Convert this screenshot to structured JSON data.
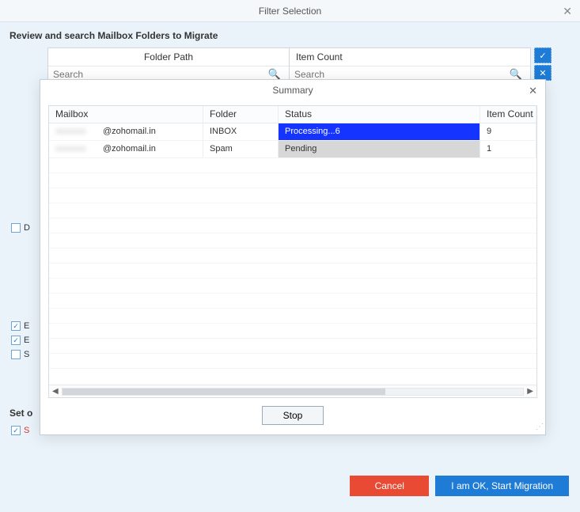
{
  "titlebar": {
    "title": "Filter Selection"
  },
  "section_label": "Review and search Mailbox Folders to Migrate",
  "filter": {
    "col1_header": "Folder Path",
    "col2_header": "Item Count",
    "search_placeholder": "Search"
  },
  "side_checks": {
    "d_label": "D",
    "e1_label": "E",
    "e2_label": "E",
    "s_label": "S",
    "set_label": "Set o",
    "s2_label": "S"
  },
  "summary": {
    "title": "Summary",
    "headers": {
      "mailbox": "Mailbox",
      "folder": "Folder",
      "status": "Status",
      "item_count": "Item Count"
    },
    "rows": [
      {
        "mailbox_domain": "@zohomail.in",
        "folder": "INBOX",
        "status": "Processing...6",
        "status_kind": "processing",
        "count": "9"
      },
      {
        "mailbox_domain": "@zohomail.in",
        "folder": "Spam",
        "status": "Pending",
        "status_kind": "pending",
        "count": "1"
      }
    ],
    "stop_label": "Stop"
  },
  "footer": {
    "cancel": "Cancel",
    "start": "I am OK, Start Migration"
  }
}
